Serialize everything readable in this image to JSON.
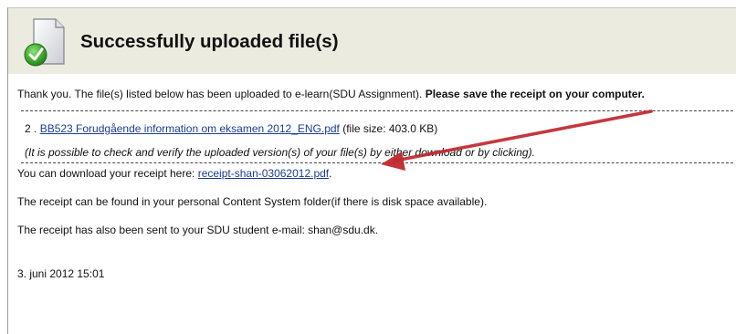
{
  "header": {
    "title": "Successfully uploaded file(s)",
    "icon": "document-upload-success-icon"
  },
  "intro": {
    "text": "Thank you. The file(s) listed below has been uploaded to e-learn(SDU Assignment). ",
    "bold": "Please save the receipt on your computer."
  },
  "file": {
    "index": "2 . ",
    "name": "BB523 Forudgående information om eksamen 2012_ENG.pdf",
    "size": " (file size: 403.0 KB)"
  },
  "note": "(It is possible to check and verify the uploaded version(s) of your file(s) by either download or by clicking).",
  "receipt": {
    "prefix": "You can download your receipt here: ",
    "link": "receipt-shan-03062012.pdf",
    "suffix": "."
  },
  "content_system_text": "The receipt can be found in your personal Content System folder(if there is disk space available).",
  "email_text": "The receipt has also been sent to your SDU student e-mail: shan@sdu.dk.",
  "date": "3. juni 2012 15:01",
  "colors": {
    "header_bg": "#ecebe0",
    "link": "#1a3d8f",
    "arrow": "#c0282d"
  }
}
